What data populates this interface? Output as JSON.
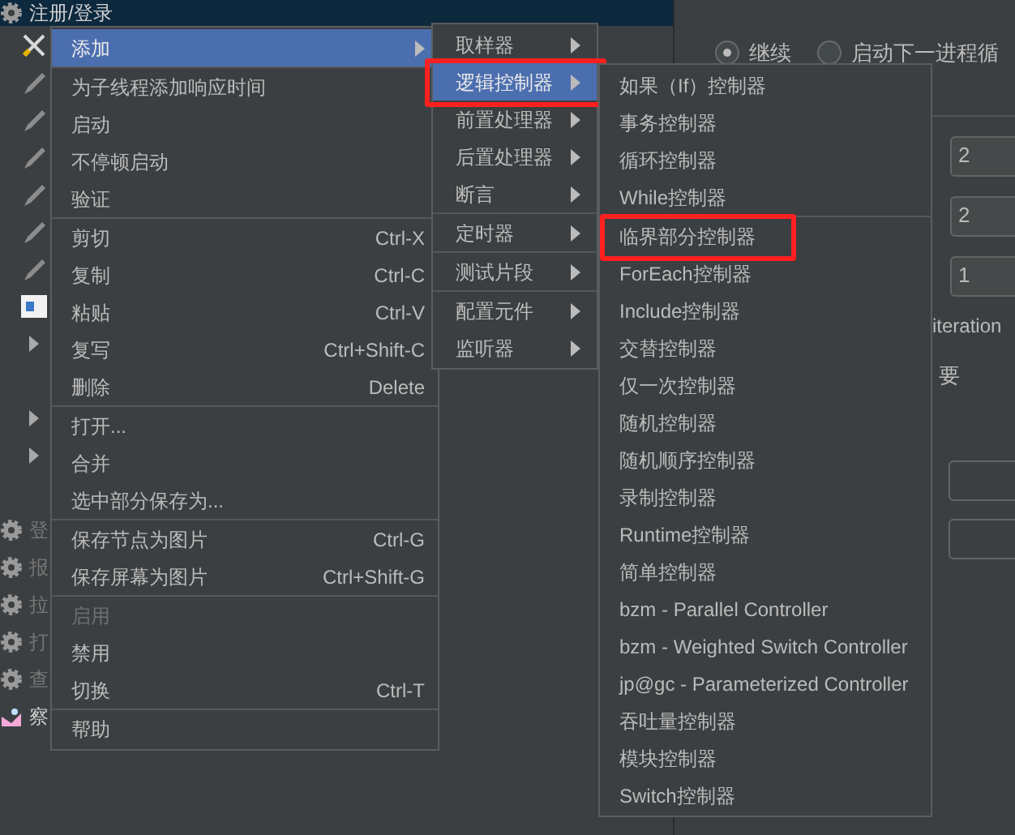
{
  "tree": {
    "rows": [
      {
        "kind": "gear",
        "label": "注册/登录",
        "selected": true,
        "disabled": false
      },
      {
        "kind": "tool",
        "selected": false
      },
      {
        "kind": "pencil",
        "selected": false
      },
      {
        "kind": "pencil",
        "selected": false
      },
      {
        "kind": "pencil",
        "selected": false
      },
      {
        "kind": "pencil",
        "selected": false
      },
      {
        "kind": "pencil",
        "selected": false
      },
      {
        "kind": "pencil",
        "selected": false
      },
      {
        "kind": "page",
        "selected": false
      },
      {
        "kind": "expander",
        "selected": false
      },
      {
        "kind": "blank",
        "selected": false
      },
      {
        "kind": "expander",
        "selected": false
      },
      {
        "kind": "expander",
        "selected": false
      },
      {
        "kind": "blank",
        "selected": false
      },
      {
        "kind": "gear",
        "label": "登",
        "selected": false,
        "disabled": true
      },
      {
        "kind": "gear",
        "label": "报",
        "selected": false,
        "disabled": true
      },
      {
        "kind": "gear",
        "label": "拉",
        "selected": false,
        "disabled": true
      },
      {
        "kind": "gear",
        "label": "打",
        "selected": false,
        "disabled": true
      },
      {
        "kind": "gear",
        "label": "查",
        "selected": false,
        "disabled": true
      },
      {
        "kind": "chart",
        "label": "察",
        "selected": false,
        "disabled": false
      }
    ]
  },
  "settings": {
    "radios": [
      {
        "label": "继续",
        "selected": true
      },
      {
        "label": "启动下一进程循",
        "selected": false
      }
    ],
    "fields": [
      "2",
      "2",
      "1"
    ],
    "iteration_text": "iteration",
    "note": "要"
  },
  "context_menu": {
    "groups": [
      [
        {
          "label": "添加",
          "submenu": true,
          "selected": true,
          "disabled": false
        }
      ],
      [
        {
          "label": "为子线程添加响应时间",
          "selected": false,
          "disabled": false
        },
        {
          "label": "启动",
          "selected": false,
          "disabled": false
        },
        {
          "label": "不停顿启动",
          "selected": false,
          "disabled": false
        },
        {
          "label": "验证",
          "selected": false,
          "disabled": false
        }
      ],
      [
        {
          "label": "剪切",
          "shortcut": "Ctrl-X",
          "selected": false,
          "disabled": false
        },
        {
          "label": "复制",
          "shortcut": "Ctrl-C",
          "selected": false,
          "disabled": false
        },
        {
          "label": "粘贴",
          "shortcut": "Ctrl-V",
          "selected": false,
          "disabled": false
        },
        {
          "label": "复写",
          "shortcut": "Ctrl+Shift-C",
          "selected": false,
          "disabled": false
        },
        {
          "label": "删除",
          "shortcut": "Delete",
          "selected": false,
          "disabled": false
        }
      ],
      [
        {
          "label": "打开...",
          "selected": false,
          "disabled": false
        },
        {
          "label": "合并",
          "selected": false,
          "disabled": false
        },
        {
          "label": "选中部分保存为...",
          "selected": false,
          "disabled": false
        }
      ],
      [
        {
          "label": "保存节点为图片",
          "shortcut": "Ctrl-G",
          "selected": false,
          "disabled": false
        },
        {
          "label": "保存屏幕为图片",
          "shortcut": "Ctrl+Shift-G",
          "selected": false,
          "disabled": false
        }
      ],
      [
        {
          "label": "启用",
          "selected": false,
          "disabled": true
        },
        {
          "label": "禁用",
          "selected": false,
          "disabled": false
        },
        {
          "label": "切换",
          "shortcut": "Ctrl-T",
          "selected": false,
          "disabled": false
        }
      ],
      [
        {
          "label": "帮助",
          "selected": false,
          "disabled": false
        }
      ]
    ]
  },
  "add_submenu": {
    "groups": [
      [
        {
          "label": "取样器",
          "submenu": true,
          "selected": false,
          "highlighted": false
        },
        {
          "label": "逻辑控制器",
          "submenu": true,
          "selected": true,
          "highlighted": true
        },
        {
          "label": "前置处理器",
          "submenu": true,
          "selected": false,
          "highlighted": false
        },
        {
          "label": "后置处理器",
          "submenu": true,
          "selected": false,
          "highlighted": false
        },
        {
          "label": "断言",
          "submenu": true,
          "selected": false,
          "highlighted": false
        }
      ],
      [
        {
          "label": "定时器",
          "submenu": true,
          "selected": false,
          "highlighted": false
        }
      ],
      [
        {
          "label": "测试片段",
          "submenu": true,
          "selected": false,
          "highlighted": false
        }
      ],
      [
        {
          "label": "配置元件",
          "submenu": true,
          "selected": false,
          "highlighted": false
        },
        {
          "label": "监听器",
          "submenu": true,
          "selected": false,
          "highlighted": false
        }
      ]
    ]
  },
  "logic_controller_submenu": {
    "groups": [
      [
        {
          "label": "如果（If）控制器",
          "highlighted": false
        },
        {
          "label": "事务控制器",
          "highlighted": false
        },
        {
          "label": "循环控制器",
          "highlighted": false
        },
        {
          "label": "While控制器",
          "highlighted": false
        }
      ],
      [
        {
          "label": "临界部分控制器",
          "highlighted": true
        },
        {
          "label": "ForEach控制器",
          "highlighted": false
        },
        {
          "label": "Include控制器",
          "highlighted": false
        },
        {
          "label": "交替控制器",
          "highlighted": false
        },
        {
          "label": "仅一次控制器",
          "highlighted": false
        },
        {
          "label": "随机控制器",
          "highlighted": false
        },
        {
          "label": "随机顺序控制器",
          "highlighted": false
        },
        {
          "label": "录制控制器",
          "highlighted": false
        },
        {
          "label": "Runtime控制器",
          "highlighted": false
        },
        {
          "label": "简单控制器",
          "highlighted": false
        },
        {
          "label": "bzm - Parallel Controller",
          "highlighted": false
        },
        {
          "label": "bzm - Weighted Switch Controller",
          "highlighted": false
        },
        {
          "label": "jp@gc - Parameterized Controller",
          "highlighted": false
        },
        {
          "label": "吞吐量控制器",
          "highlighted": false
        },
        {
          "label": "模块控制器",
          "highlighted": false
        },
        {
          "label": "Switch控制器",
          "highlighted": false
        }
      ]
    ]
  }
}
